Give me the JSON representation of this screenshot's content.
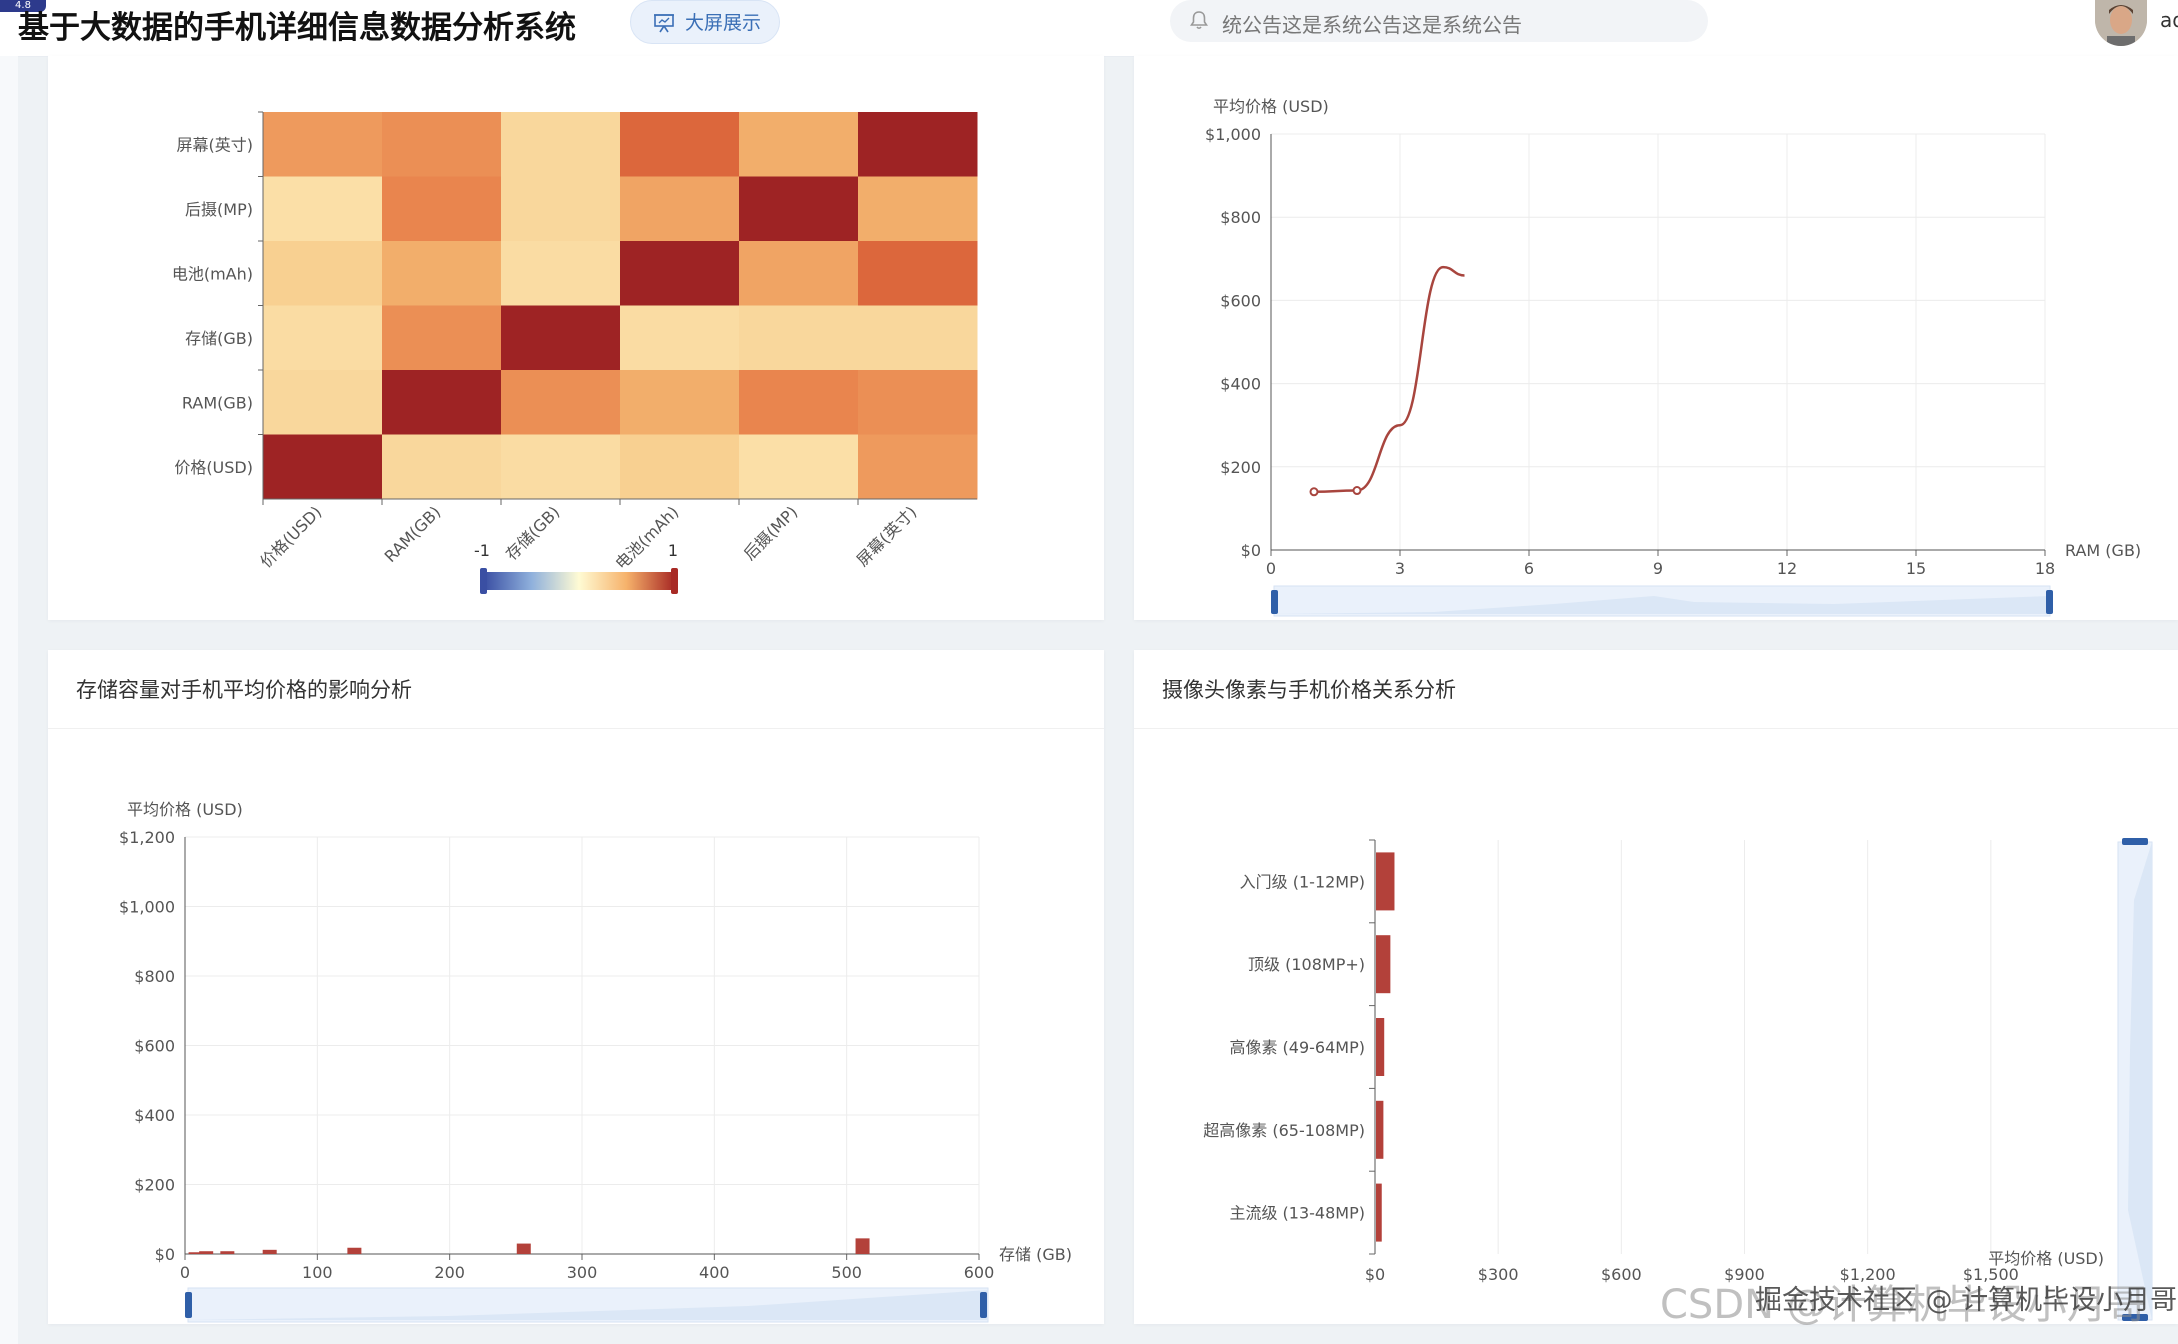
{
  "header": {
    "badge": "4.8",
    "title": "基于大数据的手机详细信息数据分析系统",
    "big_screen_label": "大屏展示",
    "notice_text": "统公告这是系统公告这是系统公告",
    "user_short": "ad"
  },
  "panels": {
    "storage_title": "存储容量对手机平均价格的影响分析",
    "camera_title": "摄像头像素与手机价格关系分析"
  },
  "watermark": {
    "csdn": "CSDN @计算机毕设小月哥",
    "juejin": "掘金技术社区 @ 计算机毕设小月哥"
  },
  "chart_data": [
    {
      "type": "heatmap",
      "x_labels": [
        "价格(USD)",
        "RAM(GB)",
        "存储(GB)",
        "电池(mAh)",
        "后摄(MP)",
        "屏幕(英寸)"
      ],
      "y_labels": [
        "价格(USD)",
        "RAM(GB)",
        "存储(GB)",
        "电池(mAh)",
        "后摄(MP)",
        "屏幕(英寸)"
      ],
      "values": [
        [
          1.0,
          0.05,
          0.02,
          0.1,
          0.0,
          0.4
        ],
        [
          0.05,
          1.0,
          0.45,
          0.3,
          0.5,
          0.45
        ],
        [
          0.02,
          0.45,
          1.0,
          0.02,
          0.05,
          0.05
        ],
        [
          0.1,
          0.3,
          0.02,
          1.0,
          0.35,
          0.65
        ],
        [
          0.0,
          0.5,
          0.05,
          0.35,
          1.0,
          0.3
        ],
        [
          0.4,
          0.45,
          0.05,
          0.65,
          0.3,
          1.0
        ]
      ],
      "visual_map": {
        "min": -1,
        "max": 1,
        "min_label": "-1",
        "max_label": "1"
      },
      "colors": [
        "#4055a8",
        "#7fa1d6",
        "#fffbd4",
        "#f6c27a",
        "#e5713f",
        "#9e2324"
      ]
    },
    {
      "type": "line",
      "ylabel": "平均价格 (USD)",
      "xlabel": "RAM (GB)",
      "x": [
        1,
        2,
        3,
        4,
        4.5
      ],
      "y": [
        140,
        143,
        300,
        680,
        660
      ],
      "xlim": [
        0,
        18
      ],
      "ylim": [
        0,
        1000
      ],
      "x_ticks": [
        "0",
        "3",
        "6",
        "9",
        "12",
        "15",
        "18"
      ],
      "y_ticks": [
        "$0",
        "$200",
        "$400",
        "$600",
        "$800",
        "$1,000"
      ],
      "color": "#a8453e"
    },
    {
      "type": "bar",
      "ylabel": "平均价格 (USD)",
      "xlabel": "存储 (GB)",
      "x": [
        8,
        16,
        32,
        64,
        128,
        256,
        512
      ],
      "y": [
        5,
        8,
        8,
        12,
        18,
        30,
        45
      ],
      "xlim": [
        0,
        600
      ],
      "ylim": [
        0,
        1200
      ],
      "x_ticks": [
        "0",
        "100",
        "200",
        "300",
        "400",
        "500",
        "600"
      ],
      "y_ticks": [
        "$0",
        "$200",
        "$400",
        "$600",
        "$800",
        "$1,000",
        "$1,200"
      ],
      "color": "#b3413a"
    },
    {
      "type": "bar",
      "orientation": "horizontal",
      "xlabel": "平均价格 (USD)",
      "categories": [
        "入门级 (1-12MP)",
        "顶级 (108MP+)",
        "高像素 (49-64MP)",
        "超高像素 (65-108MP)",
        "主流级 (13-48MP)"
      ],
      "values": [
        45,
        35,
        20,
        18,
        14
      ],
      "xlim": [
        0,
        1800
      ],
      "x_ticks": [
        "$0",
        "$300",
        "$600",
        "$900",
        "$1,200",
        "$1,500"
      ],
      "color": "#b3413a"
    }
  ]
}
